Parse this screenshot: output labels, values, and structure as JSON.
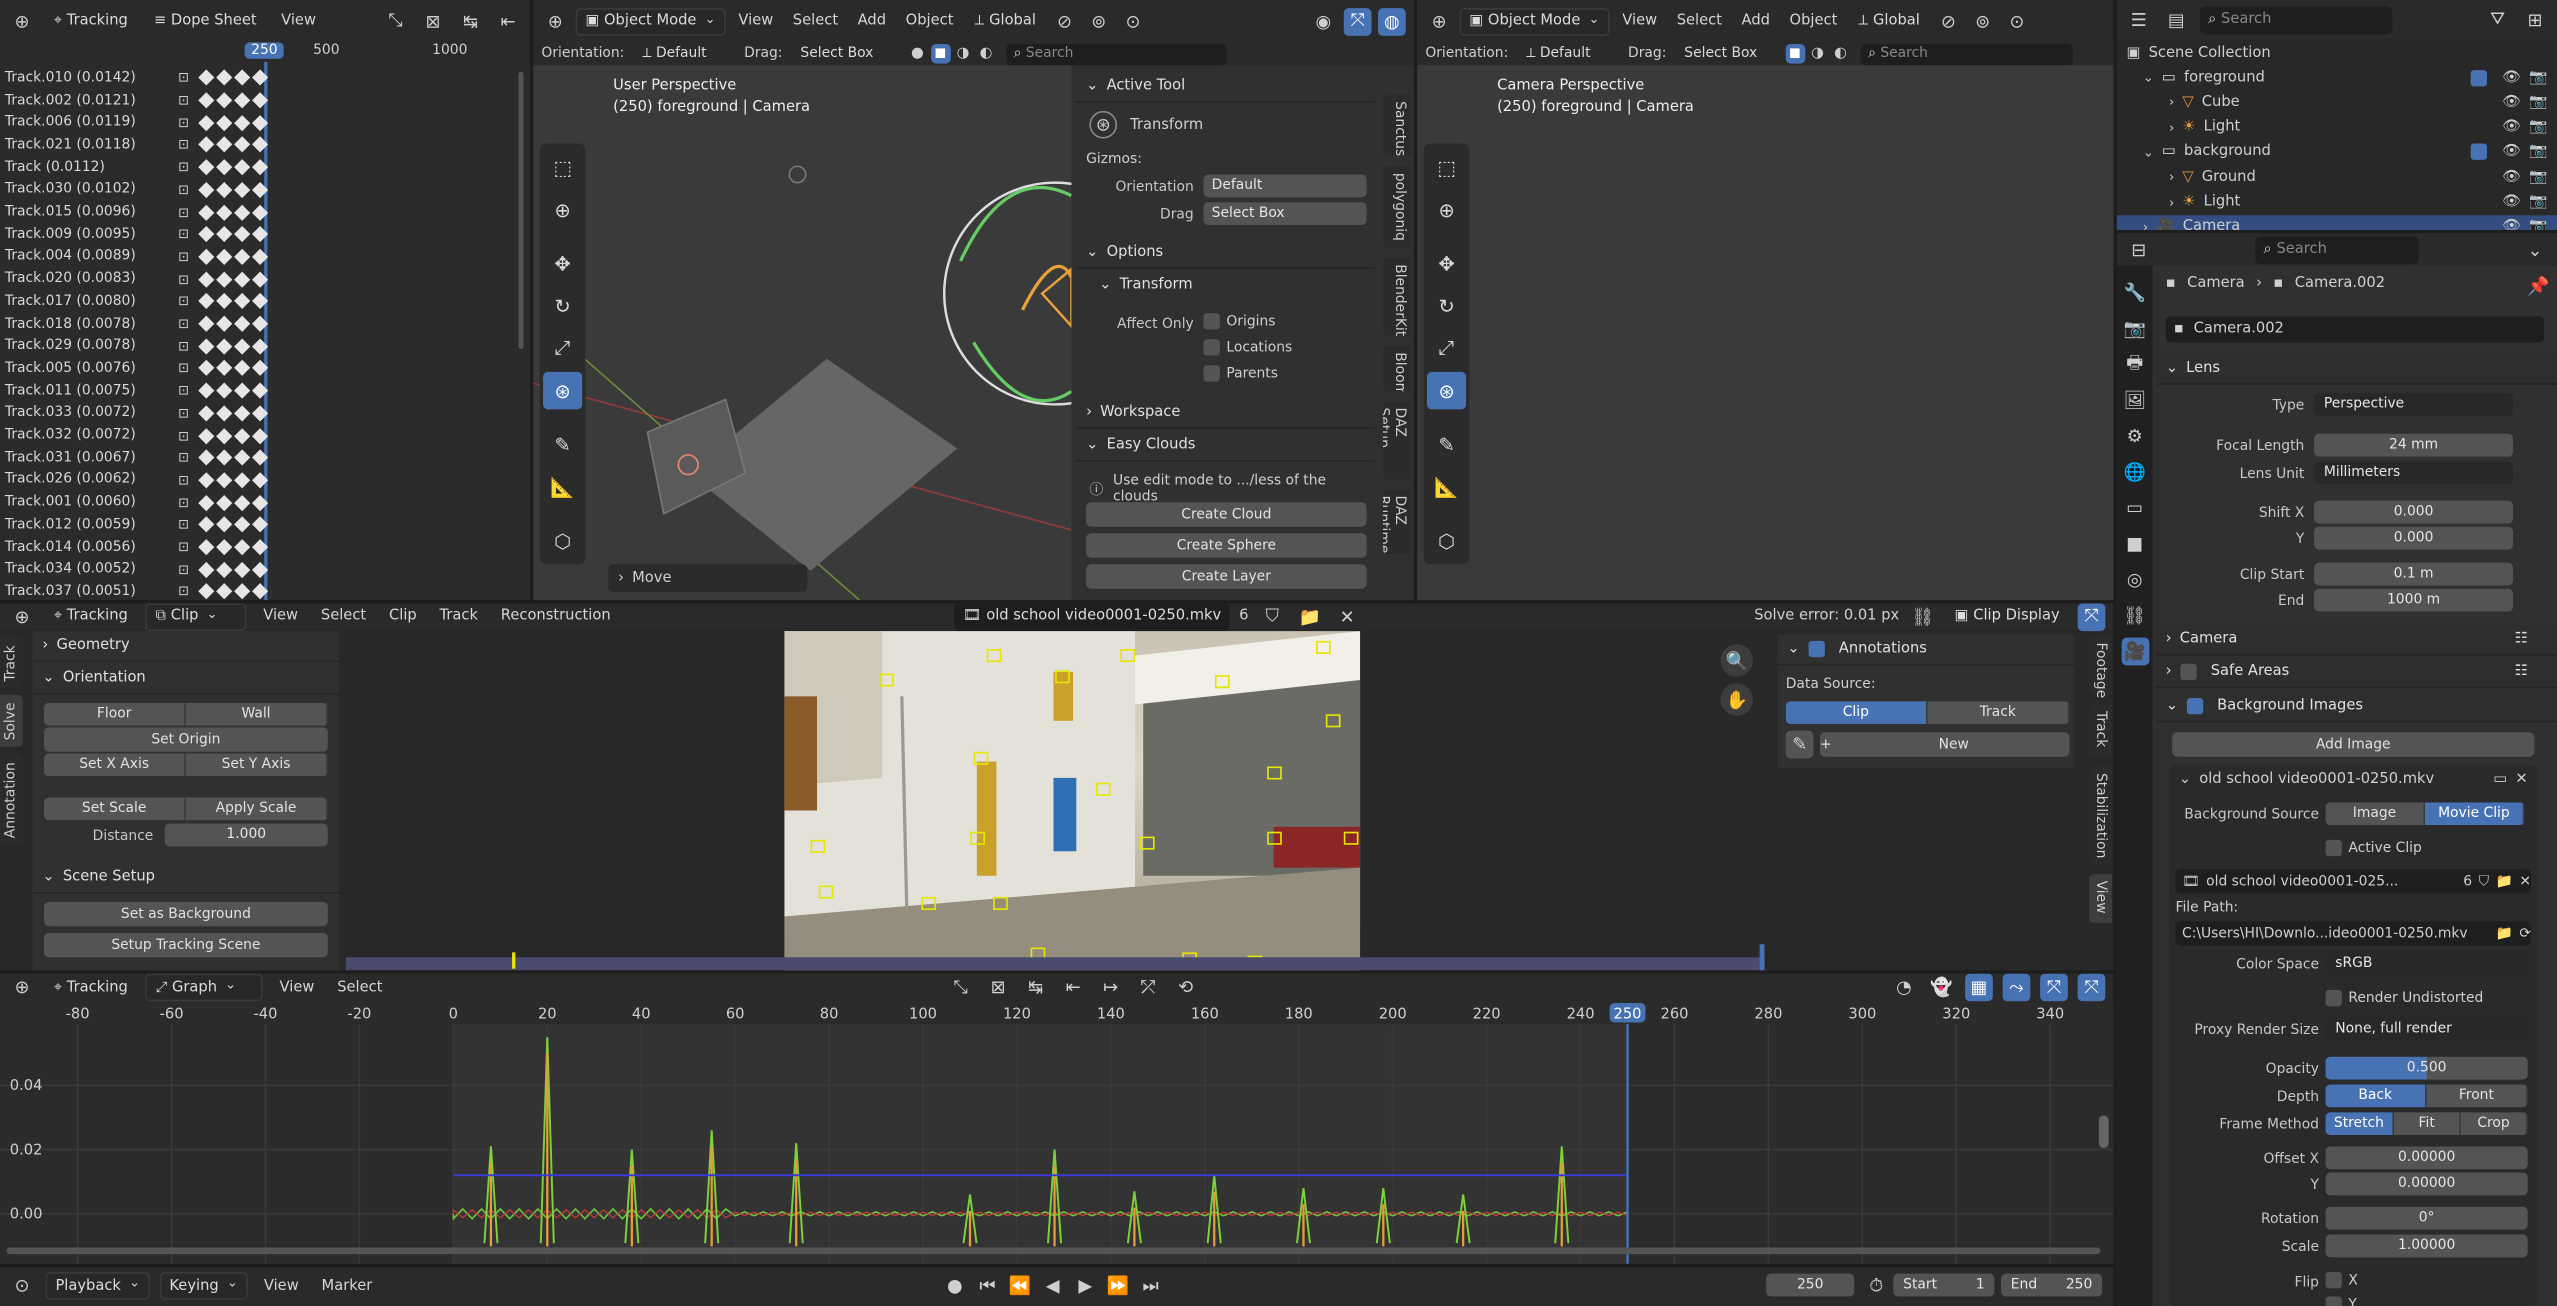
{
  "dopesheet": {
    "editor": "Tracking",
    "mode": "Dope Sheet",
    "menu": "View",
    "frames": [
      "250",
      "500",
      "1000"
    ],
    "tracks": [
      "Track.010 (0.0142)",
      "Track.002 (0.0121)",
      "Track.006 (0.0119)",
      "Track.021 (0.0118)",
      "Track (0.0112)",
      "Track.030 (0.0102)",
      "Track.015 (0.0096)",
      "Track.009 (0.0095)",
      "Track.004 (0.0089)",
      "Track.020 (0.0083)",
      "Track.017 (0.0080)",
      "Track.018 (0.0078)",
      "Track.029 (0.0078)",
      "Track.005 (0.0076)",
      "Track.011 (0.0075)",
      "Track.033 (0.0072)",
      "Track.032 (0.0072)",
      "Track.031 (0.0067)",
      "Track.026 (0.0062)",
      "Track.001 (0.0060)",
      "Track.012 (0.0059)",
      "Track.014 (0.0056)",
      "Track.034 (0.0052)",
      "Track.037 (0.0051)"
    ]
  },
  "viewport1": {
    "mode": "Object Mode",
    "menus": [
      "View",
      "Select",
      "Add",
      "Object"
    ],
    "transform": "Global",
    "orientation_label": "Orientation:",
    "orientation": "Default",
    "drag_label": "Drag:",
    "drag": "Select Box",
    "search": "Search",
    "title": "User Perspective",
    "subtitle": "(250) foreground | Camera",
    "last_op": "Move",
    "side_tabs": [
      "Sanctus",
      "polygoniq",
      "BlenderKit",
      "Bloom",
      "DAZ Setup",
      "DAZ Runtime"
    ]
  },
  "tool_panel": {
    "active_tool": "Active Tool",
    "tool_name": "Transform",
    "gizmos": "Gizmos:",
    "orientation_label": "Orientation",
    "orientation": "Default",
    "drag_label": "Drag",
    "drag": "Select Box",
    "options": "Options",
    "transform": "Transform",
    "affect_only": "Affect Only",
    "affect": [
      "Origins",
      "Locations",
      "Parents"
    ],
    "workspace": "Workspace",
    "easy_clouds": "Easy Clouds",
    "hint": "Use edit mode to .../less of the clouds",
    "buttons": [
      "Create Cloud",
      "Create Sphere",
      "Create Layer"
    ]
  },
  "viewport2": {
    "mode": "Object Mode",
    "menus": [
      "View",
      "Select",
      "Add",
      "Object"
    ],
    "transform": "Global",
    "orientation_label": "Orientation:",
    "orientation": "Default",
    "drag_label": "Drag:",
    "drag": "Select Box",
    "search": "Search",
    "title": "Camera Perspective",
    "subtitle": "(250) foreground | Camera"
  },
  "outliner": {
    "search": "Search",
    "root": "Scene Collection",
    "items": [
      {
        "name": "foreground",
        "type": "collection",
        "depth": 1
      },
      {
        "name": "Cube",
        "type": "mesh",
        "depth": 2
      },
      {
        "name": "Light",
        "type": "light",
        "depth": 2
      },
      {
        "name": "background",
        "type": "collection",
        "depth": 1
      },
      {
        "name": "Ground",
        "type": "mesh",
        "depth": 2
      },
      {
        "name": "Light",
        "type": "light",
        "depth": 2
      },
      {
        "name": "Camera",
        "type": "camera",
        "depth": 1
      }
    ]
  },
  "properties": {
    "search": "Search",
    "breadcrumb": [
      "Camera",
      "Camera.002"
    ],
    "datablock": "Camera.002",
    "lens": {
      "header": "Lens",
      "type_label": "Type",
      "type": "Perspective",
      "focal_label": "Focal Length",
      "focal": "24 mm",
      "unit_label": "Lens Unit",
      "unit": "Millimeters",
      "shiftx_label": "Shift X",
      "shiftx": "0.000",
      "shifty_label": "Y",
      "shifty": "0.000",
      "clipstart_label": "Clip Start",
      "clipstart": "0.1 m",
      "clipend_label": "End",
      "clipend": "1000 m"
    },
    "camera": "Camera",
    "safe_areas": "Safe Areas",
    "bg_images": "Background Images",
    "add_image": "Add Image",
    "bg": {
      "name": "old school video0001-0250.mkv",
      "source_label": "Background Source",
      "source_image": "Image",
      "source_clip": "Movie Clip",
      "active_clip": "Active Clip",
      "clip_name": "old school video0001-025...",
      "clip_users": "6",
      "filepath_label": "File Path:",
      "filepath": "C:\\Users\\HI\\Downlo...ideo0001-0250.mkv",
      "colorspace_label": "Color Space",
      "colorspace": "sRGB",
      "render_undistorted": "Render Undistorted",
      "proxy_label": "Proxy Render Size",
      "proxy": "None, full render",
      "opacity_label": "Opacity",
      "opacity": "0.500",
      "opacity_value": 0.5,
      "depth_label": "Depth",
      "depth_back": "Back",
      "depth_front": "Front",
      "frame_label": "Frame Method",
      "frame_stretch": "Stretch",
      "frame_fit": "Fit",
      "frame_crop": "Crop",
      "offx_label": "Offset X",
      "offx": "0.00000",
      "offy_label": "Y",
      "offy": "0.00000",
      "rot_label": "Rotation",
      "rot": "0°",
      "scale_label": "Scale",
      "scale": "1.00000",
      "flip_label": "Flip",
      "flip_x": "X",
      "flip_y": "Y"
    }
  },
  "clip_editor": {
    "editor": "Tracking",
    "mode": "Clip",
    "menus": [
      "View",
      "Select",
      "Clip",
      "Track",
      "Reconstruction"
    ],
    "clip_name": "old school video0001-0250.mkv",
    "clip_users": "6",
    "solve_error": "Solve error: 0.01 px",
    "clip_display": "Clip Display",
    "left_tabs": [
      "Track",
      "Solve",
      "Annotation"
    ],
    "right_tabs": [
      "Footage",
      "Track",
      "Stabilization",
      "View"
    ],
    "geometry": "Geometry",
    "orientation": "Orientation",
    "floor": "Floor",
    "wall": "Wall",
    "set_origin": "Set Origin",
    "set_x": "Set X Axis",
    "set_y": "Set Y Axis",
    "set_scale": "Set Scale",
    "apply_scale": "Apply Scale",
    "distance_label": "Distance",
    "distance": "1.000",
    "scene_setup": "Scene Setup",
    "set_bg": "Set as Background",
    "setup_scene": "Setup Tracking Scene",
    "annotations": "Annotations",
    "data_source": "Data Source:",
    "ds_clip": "Clip",
    "ds_track": "Track",
    "new": "New"
  },
  "graph": {
    "editor": "Tracking",
    "mode": "Graph",
    "menus": [
      "View",
      "Select"
    ],
    "current_frame": "250"
  },
  "chart_data": {
    "type": "line",
    "x_ticks": [
      -80,
      -60,
      -40,
      -20,
      0,
      20,
      40,
      60,
      80,
      100,
      120,
      140,
      160,
      180,
      200,
      220,
      240,
      250,
      260,
      280,
      300,
      320,
      340
    ],
    "y_ticks": [
      0.0,
      0.02,
      0.04
    ],
    "y_tick_labels": [
      "0.00",
      "0.02",
      "0.04"
    ],
    "xlim": [
      -100,
      350
    ],
    "ylim": [
      -0.01,
      0.055
    ],
    "spikes": [
      {
        "x": 20,
        "y": 0.055
      },
      {
        "x": 8,
        "y": 0.021
      },
      {
        "x": 38,
        "y": 0.02
      },
      {
        "x": 55,
        "y": 0.026
      },
      {
        "x": 73,
        "y": 0.022
      },
      {
        "x": 128,
        "y": 0.02
      },
      {
        "x": 162,
        "y": 0.012
      },
      {
        "x": 181,
        "y": 0.008
      },
      {
        "x": 198,
        "y": 0.008
      },
      {
        "x": 236,
        "y": 0.021
      },
      {
        "x": 110,
        "y": 0.006
      },
      {
        "x": 145,
        "y": 0.007
      },
      {
        "x": 215,
        "y": 0.006
      }
    ],
    "error_line": {
      "y": 0.012
    },
    "range": [
      0,
      250
    ]
  },
  "timeline": {
    "menus": [
      "Playback",
      "Keying",
      "View",
      "Marker"
    ],
    "frame": "250",
    "start_label": "Start",
    "start": "1",
    "end_label": "End",
    "end": "250"
  }
}
